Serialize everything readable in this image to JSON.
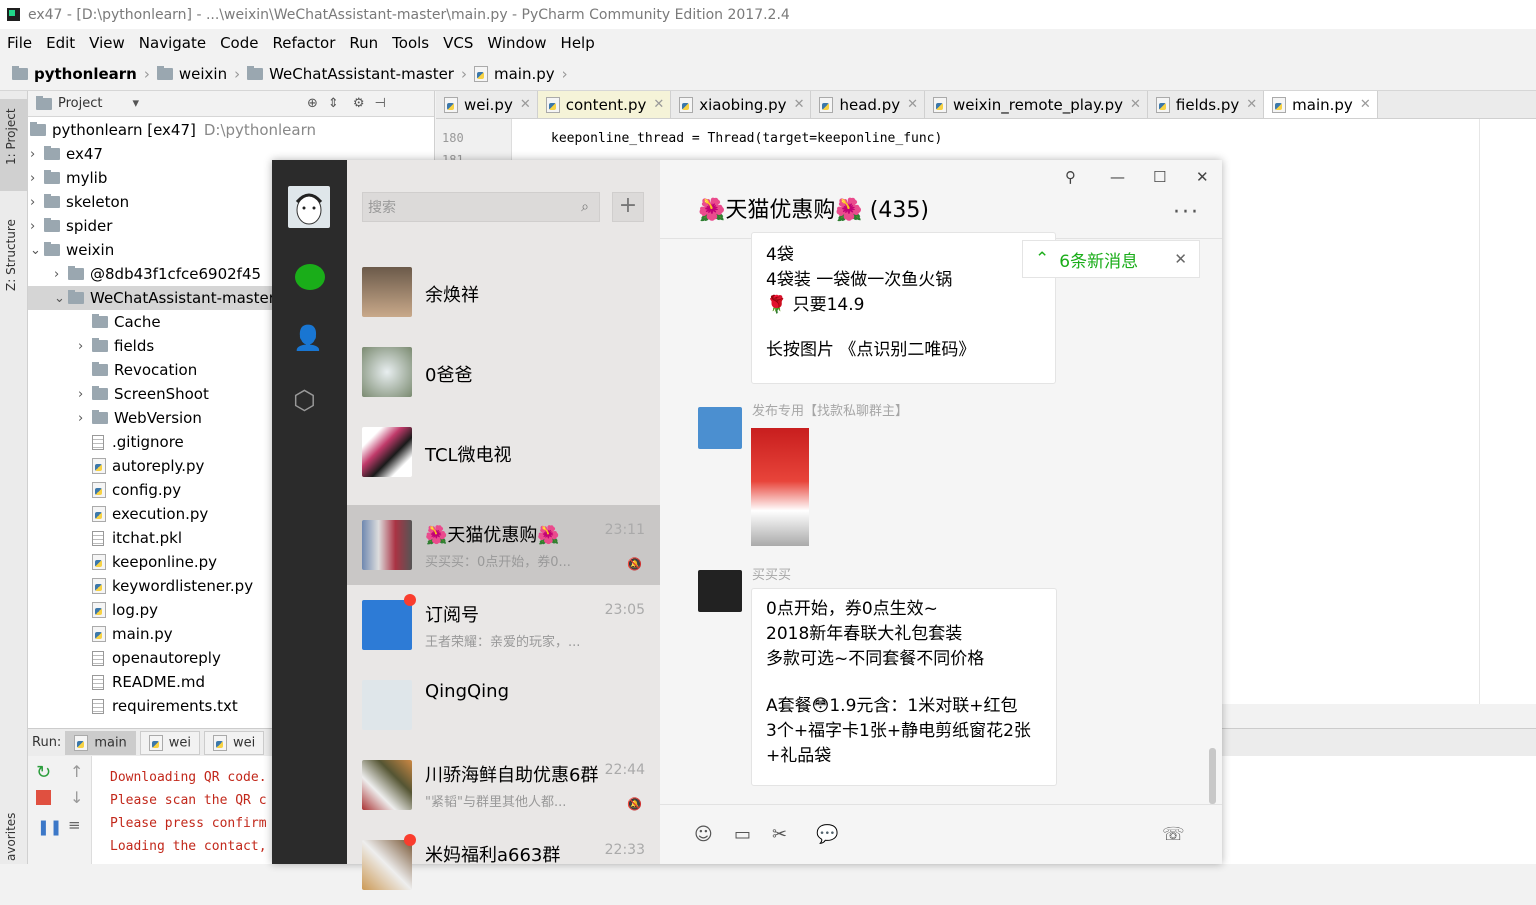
{
  "window": {
    "title": "ex47 - [D:\\pythonlearn] - ...\\weixin\\WeChatAssistant-master\\main.py - PyCharm Community Edition 2017.2.4"
  },
  "menu": [
    "File",
    "Edit",
    "View",
    "Navigate",
    "Code",
    "Refactor",
    "Run",
    "Tools",
    "VCS",
    "Window",
    "Help"
  ],
  "breadcrumb": [
    "pythonlearn",
    "weixin",
    "WeChatAssistant-master",
    "main.py"
  ],
  "side_tabs": {
    "project": "1: Project",
    "structure": "Z: Structure",
    "favorites": "avorites"
  },
  "project_panel": {
    "title": "Project",
    "tree": [
      {
        "label": "pythonlearn [ex47]",
        "extra": "D:\\pythonlearn",
        "type": "folder",
        "arrow": ""
      },
      {
        "label": "ex47",
        "type": "folder",
        "arrow": "›"
      },
      {
        "label": "mylib",
        "type": "folder",
        "arrow": "›"
      },
      {
        "label": "skeleton",
        "type": "folder",
        "arrow": "›"
      },
      {
        "label": "spider",
        "type": "folder",
        "arrow": "›"
      },
      {
        "label": "weixin",
        "type": "folder",
        "arrow": "⌄"
      },
      {
        "label": "@8db43f1cfce6902f45",
        "type": "folder",
        "arrow": "›"
      },
      {
        "label": "WeChatAssistant-master",
        "type": "folder",
        "arrow": "⌄"
      },
      {
        "label": "Cache",
        "type": "folder",
        "arrow": ""
      },
      {
        "label": "fields",
        "type": "folder",
        "arrow": "›"
      },
      {
        "label": "Revocation",
        "type": "folder",
        "arrow": ""
      },
      {
        "label": "ScreenShoot",
        "type": "folder",
        "arrow": "›"
      },
      {
        "label": "WebVersion",
        "type": "folder",
        "arrow": "›"
      },
      {
        "label": ".gitignore",
        "type": "file",
        "arrow": ""
      },
      {
        "label": "autoreply.py",
        "type": "py",
        "arrow": ""
      },
      {
        "label": "config.py",
        "type": "py",
        "arrow": ""
      },
      {
        "label": "execution.py",
        "type": "py",
        "arrow": ""
      },
      {
        "label": "itchat.pkl",
        "type": "file",
        "arrow": ""
      },
      {
        "label": "keeponline.py",
        "type": "py",
        "arrow": ""
      },
      {
        "label": "keywordlistener.py",
        "type": "py",
        "arrow": ""
      },
      {
        "label": "log.py",
        "type": "py",
        "arrow": ""
      },
      {
        "label": "main.py",
        "type": "py",
        "arrow": ""
      },
      {
        "label": "openautoreply",
        "type": "file",
        "arrow": ""
      },
      {
        "label": "README.md",
        "type": "file",
        "arrow": ""
      },
      {
        "label": "requirements.txt",
        "type": "file",
        "arrow": ""
      }
    ]
  },
  "editor_tabs": [
    "wei.py",
    "content.py",
    "xiaobing.py",
    "head.py",
    "weixin_remote_play.py",
    "fields.py",
    "main.py"
  ],
  "editor": {
    "lines": [
      {
        "num": "180",
        "code": "keeponline_thread = Thread(target=keeponline_func)"
      }
    ]
  },
  "run": {
    "label": "Run:",
    "tabs": [
      "main",
      "wei",
      "wei"
    ],
    "console": [
      "Downloading QR code.",
      "Please scan the QR c",
      "Please press confirm",
      "Loading the contact,"
    ]
  },
  "wechat": {
    "search_placeholder": "搜索",
    "plus": "+",
    "chats": [
      {
        "name": "余焕祥",
        "time": "",
        "preview": ""
      },
      {
        "name": "0爸爸",
        "time": "",
        "preview": ""
      },
      {
        "name": "TCL微电视",
        "time": "",
        "preview": ""
      },
      {
        "name": "🌺天猫优惠购🌺",
        "time": "23:11",
        "preview": "买买买：0点开始，券0..."
      },
      {
        "name": "订阅号",
        "time": "23:05",
        "preview": "王者荣耀：亲爱的玩家，..."
      },
      {
        "name": "QingQing",
        "time": "",
        "preview": ""
      },
      {
        "name": "川骄海鲜自助优惠6群",
        "time": "22:44",
        "preview": "\"紧韬\"与群里其他人都..."
      },
      {
        "name": "米妈福利a663群",
        "time": "22:33",
        "preview": ""
      }
    ],
    "chat_title": "🌺天猫优惠购🌺  (435)",
    "new_msgs": "6条新消息",
    "msg1": [
      "4袋",
      "4袋装 一袋做一次鱼火锅",
      "🌹 只要14.9",
      "",
      "长按图片 《点识别二唯码》"
    ],
    "sender2": "发布专用【找款私聊群主】",
    "sender3": "买买买",
    "msg3": [
      "0点开始，券0点生效~",
      "2018新年春联大礼包套装",
      "多款可选~不同套餐不同价格",
      "",
      "A套餐😳1.9元含：1米对联+红包",
      "3个+福字卡1张+静电剪纸窗花2张",
      "+礼品袋"
    ],
    "accent": "#1aad19"
  }
}
